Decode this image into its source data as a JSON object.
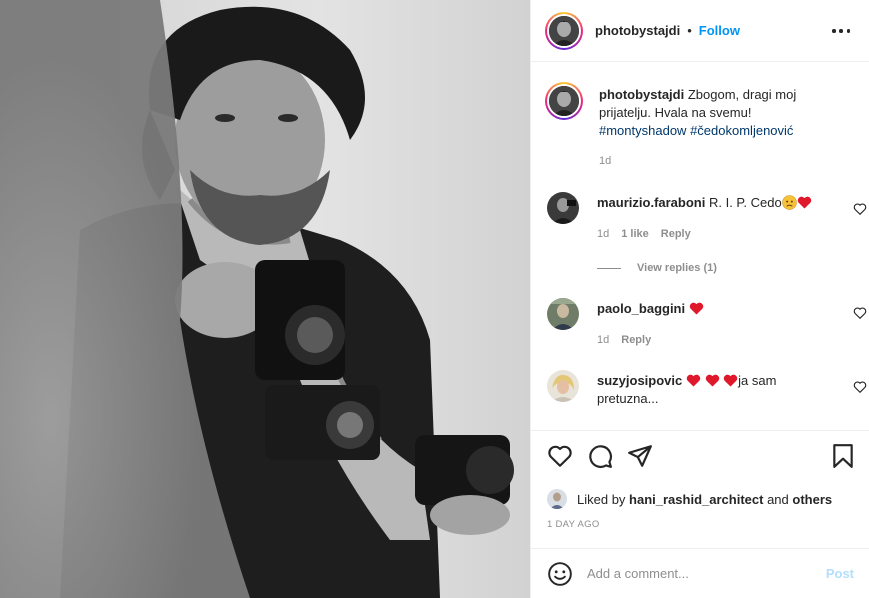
{
  "post": {
    "username": "photobystajdi",
    "follow_label": "Follow",
    "separator": "•"
  },
  "caption": {
    "username": "photobystajdi",
    "text": "Zbogom, dragi moj prijatelju. Hvala na svemu!",
    "hashtags": [
      "#montyshadow",
      "#čedokomljenović"
    ],
    "time": "1d"
  },
  "comments": [
    {
      "username": "maurizio.faraboni",
      "text": "R. I. P. Cedo",
      "emojis": [
        "sad-face",
        "red-heart"
      ],
      "time": "1d",
      "likes": "1 like",
      "reply_label": "Reply"
    },
    {
      "username": "paolo_baggini",
      "text": "",
      "emojis": [
        "red-heart"
      ],
      "time": "1d",
      "reply_label": "Reply"
    },
    {
      "username": "suzyjosipovic",
      "text": "ja sam pretuzna...",
      "emojis": [
        "red-heart",
        "red-heart",
        "red-heart"
      ]
    }
  ],
  "view_replies": "View replies (1)",
  "likes": {
    "prefix": "Liked by",
    "user": "hani_rashid_architect",
    "and": "and",
    "others": "others"
  },
  "posted_ago": "1 DAY AGO",
  "add_comment": {
    "placeholder": "Add a comment...",
    "post_label": "Post"
  },
  "colors": {
    "link_blue": "#0095f6",
    "hashtag_blue": "#00376b",
    "muted_gray": "#8e8e8e",
    "heart_red": "#ed4956",
    "post_disabled": "#b2dffc"
  },
  "icons": [
    "more-icon",
    "heart-icon",
    "comment-icon",
    "share-icon",
    "save-icon",
    "emoji-icon"
  ]
}
